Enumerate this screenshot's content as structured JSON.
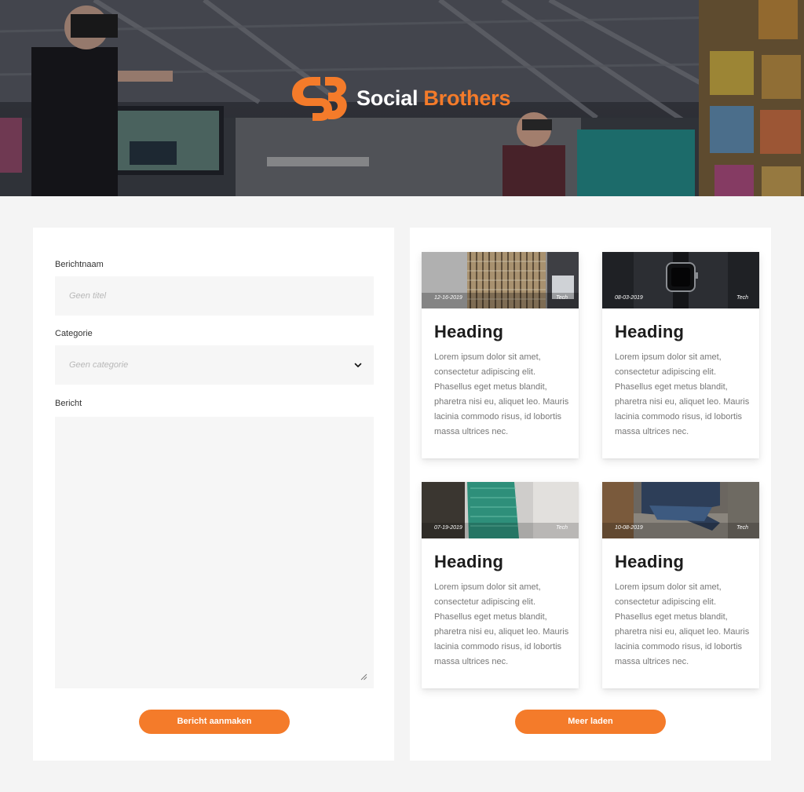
{
  "brand": {
    "word1": "Social",
    "word2": "Brothers",
    "accent_color": "#f47b2a",
    "logo_icon": "social-brothers-logo-icon"
  },
  "form": {
    "name_label": "Berichtnaam",
    "name_placeholder": "Geen titel",
    "category_label": "Categorie",
    "category_placeholder": "Geen categorie",
    "message_label": "Bericht",
    "submit_label": "Bericht aanmaken"
  },
  "posts": [
    {
      "date": "12-16-2019",
      "tag": "Tech",
      "heading": "Heading",
      "body": "Lorem ipsum dolor sit amet, consectetur adipiscing elit. Phasellus eget metus blandit, pharetra nisi eu, aliquet leo. Mauris lacinia commodo risus, id lobortis massa ultrices nec.",
      "image": "building-facade-photo"
    },
    {
      "date": "08-03-2019",
      "tag": "Tech",
      "heading": "Heading",
      "body": "Lorem ipsum dolor sit amet, consectetur adipiscing elit. Phasellus eget metus blandit, pharetra nisi eu, aliquet leo. Mauris lacinia commodo risus, id lobortis massa ultrices nec.",
      "image": "smartwatch-photo"
    },
    {
      "date": "07-19-2019",
      "tag": "Tech",
      "heading": "Heading",
      "body": "Lorem ipsum dolor sit amet, consectetur adipiscing elit. Phasellus eget metus blandit, pharetra nisi eu, aliquet leo. Mauris lacinia commodo risus, id lobortis massa ultrices nec.",
      "image": "green-fabric-photo"
    },
    {
      "date": "10-08-2019",
      "tag": "Tech",
      "heading": "Heading",
      "body": "Lorem ipsum dolor sit amet, consectetur adipiscing elit. Phasellus eget metus blandit, pharetra nisi eu, aliquet leo. Mauris lacinia commodo risus, id lobortis massa ultrices nec.",
      "image": "person-sitting-photo"
    }
  ],
  "load_more_label": "Meer laden"
}
